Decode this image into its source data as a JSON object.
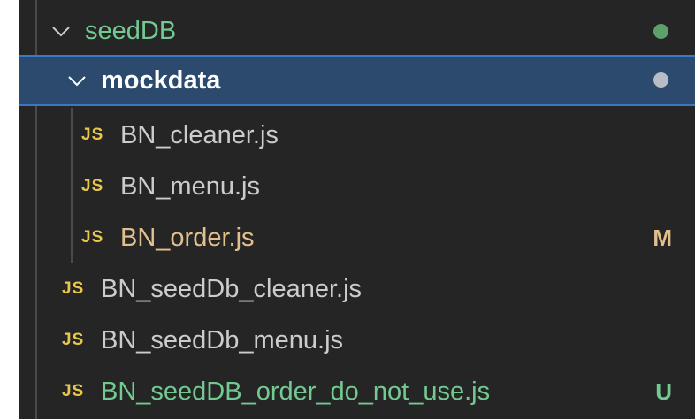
{
  "colors": {
    "background": "#252526",
    "selection": "#2b4a6e",
    "untracked": "#73c991",
    "modified": "#e2c08d",
    "js_icon": "#e8c84a",
    "dot_green": "#5f9f6a",
    "dot_grey": "#b8bcc4"
  },
  "tree": {
    "seeddb": {
      "label": "seedDB",
      "icon": "chevron-down-icon",
      "status": "dot"
    },
    "mockdata": {
      "label": "mockdata",
      "icon": "chevron-down-icon",
      "status": "dot"
    },
    "files": [
      {
        "icon_text": "JS",
        "label": "BN_cleaner.js",
        "badge": ""
      },
      {
        "icon_text": "JS",
        "label": "BN_menu.js",
        "badge": ""
      },
      {
        "icon_text": "JS",
        "label": "BN_order.js",
        "badge": "M"
      },
      {
        "icon_text": "JS",
        "label": "BN_seedDb_cleaner.js",
        "badge": ""
      },
      {
        "icon_text": "JS",
        "label": "BN_seedDb_menu.js",
        "badge": ""
      },
      {
        "icon_text": "JS",
        "label": "BN_seedDB_order_do_not_use.js",
        "badge": "U"
      }
    ]
  }
}
